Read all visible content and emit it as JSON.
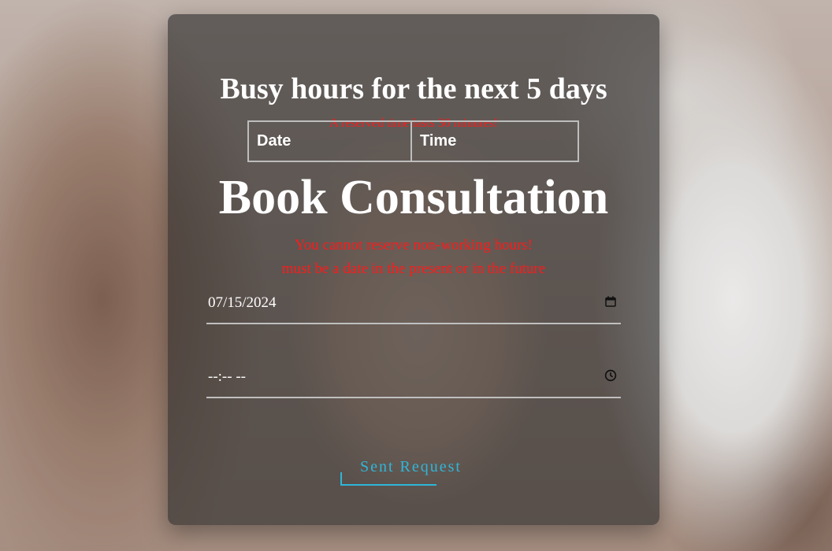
{
  "busy_section": {
    "title": "Busy hours for the next 5 days",
    "note": "A reserved time lasts 30 minutes!",
    "table_headers": [
      "Date",
      "Time"
    ]
  },
  "booking": {
    "title": "Book Consultation",
    "errors": [
      "You cannot reserve non-working hours!",
      "must be a date in the present or in the future"
    ],
    "date_value": "07/15/2024",
    "time_value": "--:-- --",
    "date_icon": "calendar-icon",
    "time_icon": "clock-icon",
    "submit_label": "Sent Request"
  },
  "colors": {
    "error": "#ff1a1a",
    "accent": "#2fb6d9",
    "panel": "rgba(40,40,40,0.62)"
  }
}
